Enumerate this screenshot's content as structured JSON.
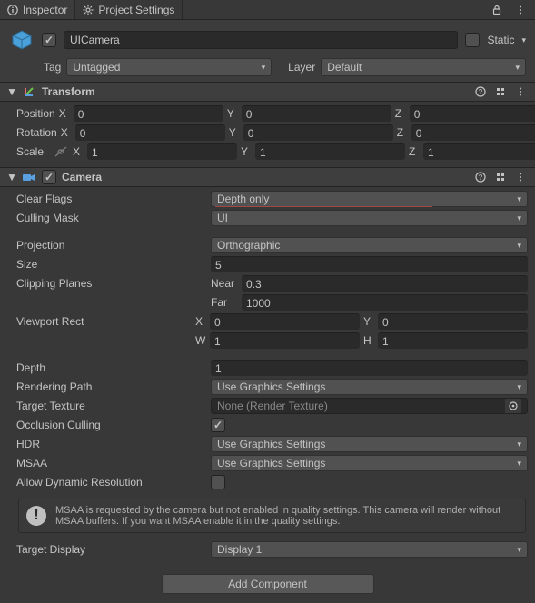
{
  "tabs": {
    "inspector": "Inspector",
    "project_settings": "Project Settings"
  },
  "gameobject": {
    "enabled": true,
    "name": "UICamera",
    "static_label": "Static",
    "static": false,
    "tag_label": "Tag",
    "tag_value": "Untagged",
    "layer_label": "Layer",
    "layer_value": "Default"
  },
  "transform": {
    "title": "Transform",
    "position_label": "Position",
    "position": {
      "x": "0",
      "y": "0",
      "z": "0"
    },
    "rotation_label": "Rotation",
    "rotation": {
      "x": "0",
      "y": "0",
      "z": "0"
    },
    "scale_label": "Scale",
    "scale": {
      "x": "1",
      "y": "1",
      "z": "1"
    }
  },
  "camera": {
    "title": "Camera",
    "enabled": true,
    "clear_flags_label": "Clear Flags",
    "clear_flags": "Depth only",
    "culling_mask_label": "Culling Mask",
    "culling_mask": "UI",
    "projection_label": "Projection",
    "projection": "Orthographic",
    "size_label": "Size",
    "size": "5",
    "clipping_label": "Clipping Planes",
    "near_label": "Near",
    "near": "0.3",
    "far_label": "Far",
    "far": "1000",
    "viewport_label": "Viewport Rect",
    "viewport": {
      "x": "0",
      "y": "0",
      "w": "1",
      "h": "1"
    },
    "depth_label": "Depth",
    "depth": "1",
    "rendering_path_label": "Rendering Path",
    "rendering_path": "Use Graphics Settings",
    "target_texture_label": "Target Texture",
    "target_texture": "None (Render Texture)",
    "occlusion_label": "Occlusion Culling",
    "occlusion": true,
    "hdr_label": "HDR",
    "hdr": "Use Graphics Settings",
    "msaa_label": "MSAA",
    "msaa": "Use Graphics Settings",
    "dynres_label": "Allow Dynamic Resolution",
    "dynres": false,
    "msaa_help": "MSAA is requested by the camera but not enabled in quality settings. This camera will render without MSAA buffers. If you want MSAA enable it in the quality settings.",
    "target_display_label": "Target Display",
    "target_display": "Display 1"
  },
  "add_component_label": "Add Component"
}
